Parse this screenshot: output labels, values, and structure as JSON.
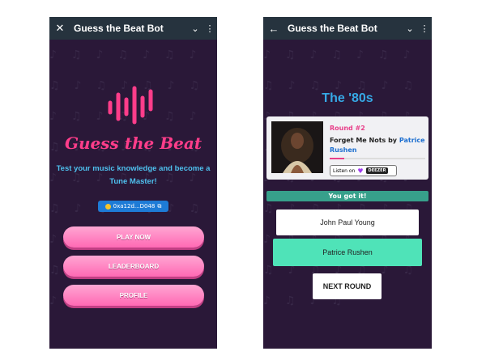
{
  "left_screen": {
    "topbar": {
      "lead_icon": "close-icon",
      "title": "Guess the Beat Bot",
      "chevron_icon": "chevron-down-icon",
      "menu_icon": "more-vertical-icon"
    },
    "brand_title": "Guess the Beat",
    "tagline": "Test your music knowledge and become a Tune Master!",
    "wallet": {
      "address": "0xa12d...D048",
      "copy_icon": "copy-icon"
    },
    "buttons": {
      "play": "PLAY NOW",
      "leaderboard": "LEADERBOARD",
      "profile": "PROFILE"
    },
    "colors": {
      "background": "#2a1838",
      "accent": "#ff3d8a",
      "tagline": "#4ec0ee",
      "button": "#ff69b4"
    }
  },
  "right_screen": {
    "topbar": {
      "lead_icon": "back-arrow-icon",
      "title": "Guess the Beat Bot",
      "chevron_icon": "chevron-down-icon",
      "menu_icon": "more-vertical-icon"
    },
    "era": "The '80s",
    "card": {
      "round": "Round #2",
      "song": "Forget Me Nots by",
      "artist": "Patrice Rushen",
      "progress": 0.15,
      "listen_label": "Listen on",
      "provider": "DEEZER"
    },
    "result": "You got it!",
    "answers": [
      "John Paul Young",
      "Patrice Rushen"
    ],
    "next_button": "NEXT ROUND",
    "colors": {
      "result": "#37a08b",
      "correct_answer": "#4fe3b8"
    }
  }
}
